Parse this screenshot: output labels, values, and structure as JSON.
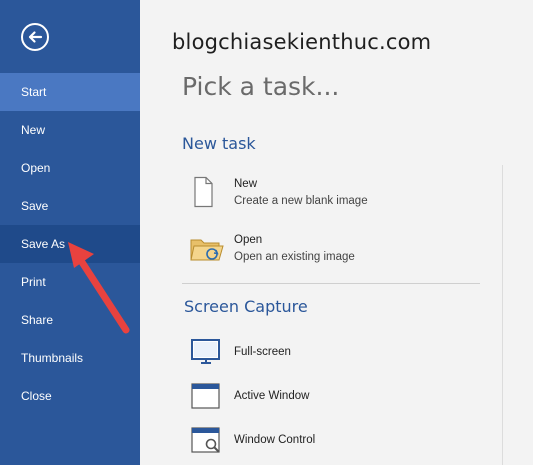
{
  "watermark": "blogchiasekienthuc.com",
  "sidebar": {
    "items": [
      {
        "label": "Start",
        "state": "active"
      },
      {
        "label": "New",
        "state": ""
      },
      {
        "label": "Open",
        "state": ""
      },
      {
        "label": "Save",
        "state": ""
      },
      {
        "label": "Save As",
        "state": "hover"
      },
      {
        "label": "Print",
        "state": ""
      },
      {
        "label": "Share",
        "state": ""
      },
      {
        "label": "Thumbnails",
        "state": ""
      },
      {
        "label": "Close",
        "state": ""
      }
    ]
  },
  "main": {
    "title": "Pick a task...",
    "new_task": {
      "heading": "New task",
      "items": [
        {
          "name": "New",
          "desc": "Create a new blank image",
          "icon": "blank-page-icon"
        },
        {
          "name": "Open",
          "desc": "Open an existing image",
          "icon": "open-folder-icon"
        }
      ]
    },
    "screen_capture": {
      "heading": "Screen Capture",
      "items": [
        {
          "name": "Full-screen",
          "icon": "monitor-icon"
        },
        {
          "name": "Active Window",
          "icon": "window-icon"
        },
        {
          "name": "Window Control",
          "icon": "window-control-icon"
        }
      ]
    }
  },
  "colors": {
    "sidebar": "#2b579a",
    "active": "#4a78c2",
    "hover": "#1f4a8a",
    "accent_arrow": "#e8423f"
  }
}
